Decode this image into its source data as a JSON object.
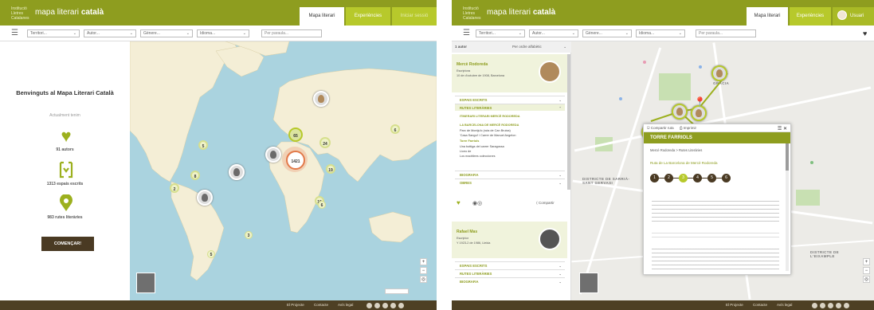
{
  "left": {
    "header": {
      "logo_small": "Institució\nLletres\nCatalanes",
      "brand_plain": "mapa literari",
      "brand_bold": "català",
      "tabs": [
        "Mapa literari",
        "Experiències",
        "Iniciar sessió"
      ]
    },
    "filters": {
      "selects": [
        "Territori...",
        "Autor...",
        "Gènere...",
        "Idioma..."
      ],
      "search_placeholder": "Per paraula..."
    },
    "welcome": {
      "title": "Benvinguts al Mapa Literari Català",
      "subtitle": "Actualment tenim",
      "stats": [
        {
          "icon": "heart-icon",
          "label": "91 autors"
        },
        {
          "icon": "book-icon",
          "label": "1313 espais escrits"
        },
        {
          "icon": "map-pin-icon",
          "label": "983 rutes literàries"
        }
      ],
      "button": "COMENÇAR!"
    },
    "map": {
      "clusters": [
        "65",
        "24",
        "1421",
        "19",
        "5",
        "6",
        "8",
        "16",
        "2",
        "6",
        "3",
        "5"
      ]
    },
    "footer": {
      "links": [
        "El Projecte",
        "Contacte",
        "Avís legal"
      ]
    }
  },
  "right": {
    "header": {
      "logo_small": "Institució\nLletres\nCatalanes",
      "brand_plain": "mapa literari",
      "brand_bold": "català",
      "tabs": [
        "Mapa literari",
        "Experiències"
      ],
      "user": "Usuari"
    },
    "filters": {
      "selects": [
        "Territori...",
        "Autor...",
        "Gènere...",
        "Idioma..."
      ],
      "search_placeholder": "Per paraula..."
    },
    "sidebar": {
      "count_label": "1 autor",
      "sort_label": "Per ordre alfabètic",
      "author1": {
        "name": "Mercè Rodoreda",
        "role": "Escriptora",
        "dates": "10 de d'octubre de 1908, Barcelona",
        "sections": [
          {
            "label": "ESPAIS ESCRITS"
          },
          {
            "label": "RUTES LITERÀRIES"
          }
        ],
        "items": [
          {
            "text": "ITINERARI LITERARI MERCÈ RODOREDA",
            "style": "green"
          },
          {
            "text": "LA BARCELONA DE MERCÈ RODOREDA",
            "style": "green"
          },
          {
            "text": "Parc de Montjuïc (ruta de Can Bruixa)",
            "style": "plain"
          },
          {
            "text": "'Casa Sangui' i Carrer de Manuel Angelon",
            "style": "plain"
          },
          {
            "text": "Torre Farriols",
            "style": "green"
          },
          {
            "text": "Una bottiga del carrer Saragossa",
            "style": "plain"
          },
          {
            "text": "Liceo de",
            "style": "plain"
          },
          {
            "text": "Los madrilees colecciones",
            "style": "plain"
          }
        ],
        "sections2": [
          {
            "label": "BIOGRAFIA"
          },
          {
            "label": "OBRES"
          }
        ],
        "share": "Compartir"
      },
      "author2": {
        "name": "Rafael Mas",
        "role": "Escriptor",
        "dates": "Y 1923-2 de 1986, Lleida",
        "sections": [
          {
            "label": "ESPAIS ESCRITS"
          },
          {
            "label": "RUTES LITERÀRIES"
          },
          {
            "label": "BIOGRAFIA"
          }
        ]
      }
    },
    "map": {
      "district_1": "DISTRICTE DE SARRIÀ-SANT GERVASI",
      "district_2": "DISTRICTE DE SARRIÀ-SANT GERVASI",
      "place": "GRÀCIA",
      "district_3": "DISTRICTE DE L'EIXAMPLE",
      "popup": {
        "bar_left": "Compartir ruta",
        "bar_right": "Imprimir",
        "title": "TORRE FARRIOLS",
        "crumb": "Mercè Rodoreda > Rutes Literàries",
        "route": "Ruta de La Barcelona de Mercè Rodoreda",
        "steps": [
          "1",
          "2",
          "3",
          "4",
          "5",
          "6"
        ]
      }
    },
    "footer": {
      "links": [
        "El Projecte",
        "Contacte",
        "Avís legal"
      ]
    }
  }
}
